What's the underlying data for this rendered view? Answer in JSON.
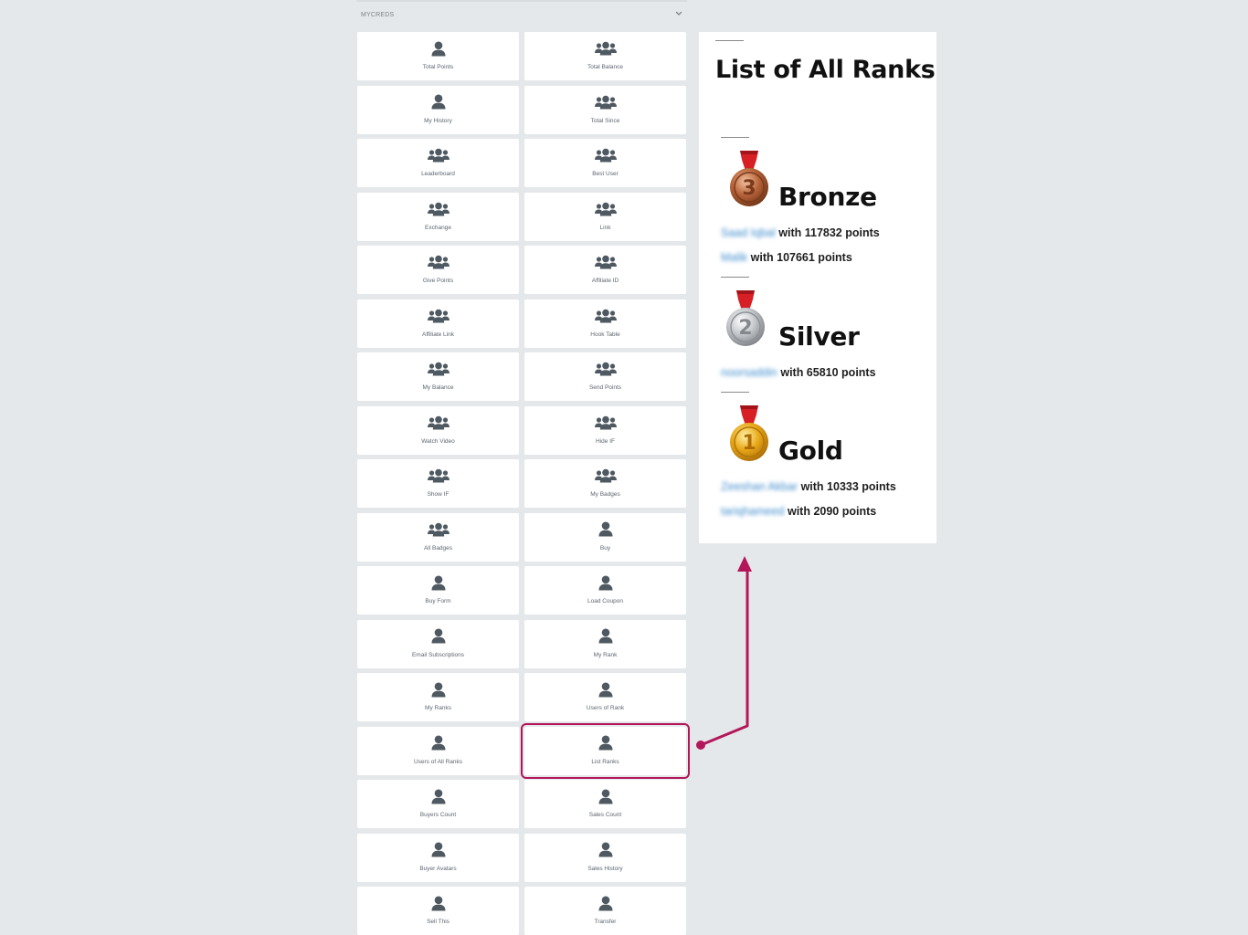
{
  "panel": {
    "title": "MYCREDS",
    "toggle_icon": "chevron-down-icon"
  },
  "widgets": [
    {
      "label": "Total Points",
      "icon": "user-icon"
    },
    {
      "label": "Total Balance",
      "icon": "users-icon"
    },
    {
      "label": "My History",
      "icon": "user-icon"
    },
    {
      "label": "Total Since",
      "icon": "users-icon"
    },
    {
      "label": "Leaderboard",
      "icon": "users-icon"
    },
    {
      "label": "Best User",
      "icon": "users-icon"
    },
    {
      "label": "Exchange",
      "icon": "users-icon"
    },
    {
      "label": "Link",
      "icon": "users-icon"
    },
    {
      "label": "Give Points",
      "icon": "users-icon"
    },
    {
      "label": "Affiliate ID",
      "icon": "users-icon"
    },
    {
      "label": "Affiliate Link",
      "icon": "users-icon"
    },
    {
      "label": "Hook Table",
      "icon": "users-icon"
    },
    {
      "label": "My Balance",
      "icon": "users-icon"
    },
    {
      "label": "Send Points",
      "icon": "users-icon"
    },
    {
      "label": "Watch Video",
      "icon": "users-icon"
    },
    {
      "label": "Hide IF",
      "icon": "users-icon"
    },
    {
      "label": "Show IF",
      "icon": "users-icon"
    },
    {
      "label": "My Badges",
      "icon": "users-icon"
    },
    {
      "label": "All Badges",
      "icon": "users-icon"
    },
    {
      "label": "Buy",
      "icon": "user-icon"
    },
    {
      "label": "Buy Form",
      "icon": "user-icon"
    },
    {
      "label": "Load Coupon",
      "icon": "user-icon"
    },
    {
      "label": "Email Subscriptions",
      "icon": "user-icon"
    },
    {
      "label": "My Rank",
      "icon": "user-icon"
    },
    {
      "label": "My Ranks",
      "icon": "user-icon"
    },
    {
      "label": "Users of Rank",
      "icon": "user-icon"
    },
    {
      "label": "Users of All Ranks",
      "icon": "user-icon"
    },
    {
      "label": "List Ranks",
      "icon": "user-icon",
      "highlighted": true
    },
    {
      "label": "Buyers Count",
      "icon": "user-icon"
    },
    {
      "label": "Sales Count",
      "icon": "user-icon"
    },
    {
      "label": "Buyer Avatars",
      "icon": "user-icon"
    },
    {
      "label": "Sales History",
      "icon": "user-icon"
    },
    {
      "label": "Sell This",
      "icon": "user-icon"
    },
    {
      "label": "Transfer",
      "icon": "user-icon"
    }
  ],
  "colors": {
    "page_bg": "#e5e8ea",
    "icon": "#4f5962",
    "highlight": "#b3175a",
    "user_name_link": "#3e8ccd"
  },
  "ranks": {
    "title": "List of All Ranks",
    "items": [
      {
        "name": "Bronze",
        "medal": "bronze-medal-icon",
        "medal_number": "3",
        "users": [
          {
            "name": "Saad Iqbal",
            "text": "with 117832 points"
          },
          {
            "name": "Malik",
            "text": "with 107661 points"
          }
        ]
      },
      {
        "name": "Silver",
        "medal": "silver-medal-icon",
        "medal_number": "2",
        "users": [
          {
            "name": "noorsaddin",
            "text": "with 65810 points"
          }
        ]
      },
      {
        "name": "Gold",
        "medal": "gold-medal-icon",
        "medal_number": "1",
        "users": [
          {
            "name": "Zeeshan Akbar",
            "text": "with 10333 points"
          },
          {
            "name": "tariqhameed",
            "text": "with 2090 points"
          }
        ]
      }
    ]
  }
}
